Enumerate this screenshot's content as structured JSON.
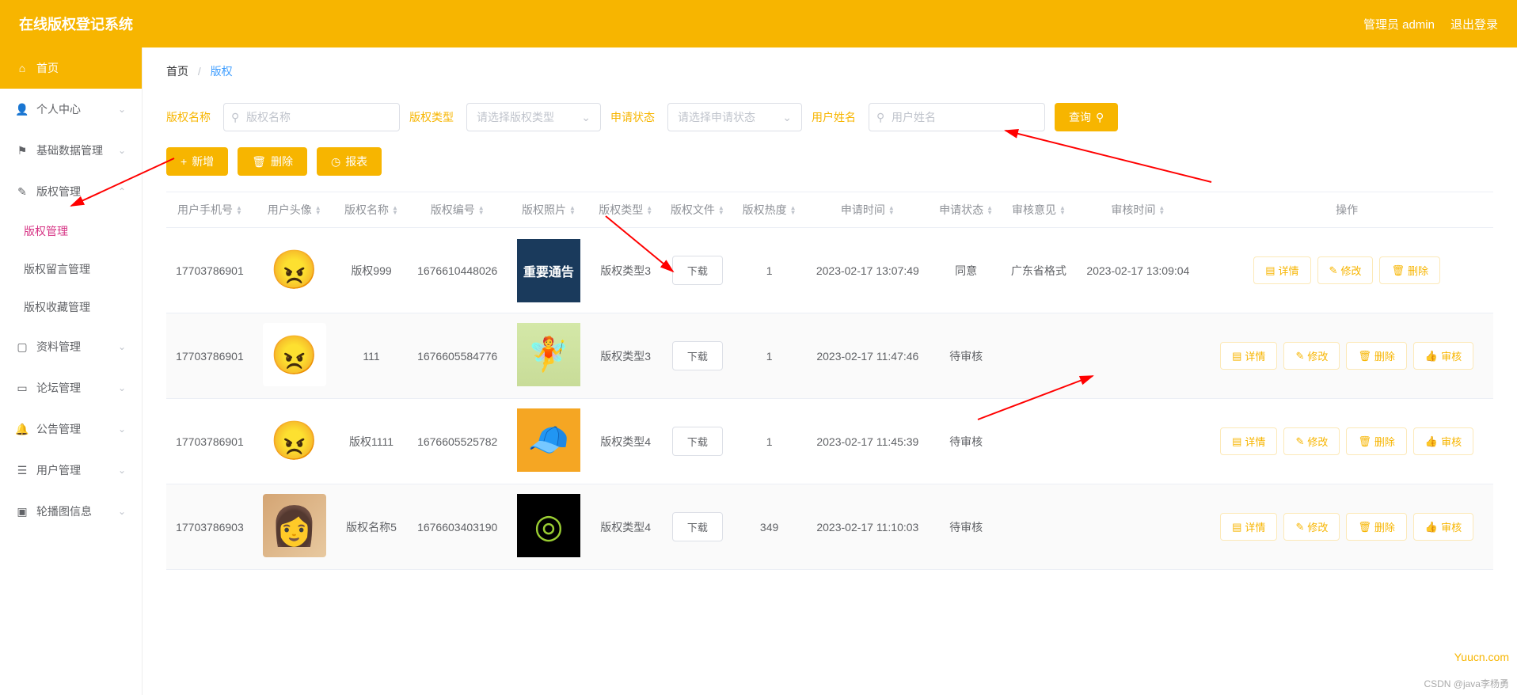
{
  "header": {
    "title": "在线版权登记系统",
    "admin_label": "管理员 admin",
    "logout_label": "退出登录"
  },
  "sidebar": {
    "items": [
      {
        "icon": "home",
        "label": "首页",
        "active_home": true
      },
      {
        "icon": "user",
        "label": "个人中心",
        "expandable": true
      },
      {
        "icon": "flag",
        "label": "基础数据管理",
        "expandable": true
      },
      {
        "icon": "copyright",
        "label": "版权管理",
        "expandable": true,
        "expanded": true,
        "children": [
          {
            "label": "版权管理",
            "active": true
          },
          {
            "label": "版权留言管理"
          },
          {
            "label": "版权收藏管理"
          }
        ]
      },
      {
        "icon": "file",
        "label": "资料管理",
        "expandable": true
      },
      {
        "icon": "forum",
        "label": "论坛管理",
        "expandable": true
      },
      {
        "icon": "announce",
        "label": "公告管理",
        "expandable": true
      },
      {
        "icon": "users",
        "label": "用户管理",
        "expandable": true
      },
      {
        "icon": "carousel",
        "label": "轮播图信息",
        "expandable": true
      }
    ]
  },
  "breadcrumb": {
    "home": "首页",
    "current": "版权"
  },
  "filters": {
    "name_label": "版权名称",
    "name_placeholder": "版权名称",
    "type_label": "版权类型",
    "type_placeholder": "请选择版权类型",
    "status_label": "申请状态",
    "status_placeholder": "请选择申请状态",
    "user_label": "用户姓名",
    "user_placeholder": "用户姓名",
    "search_btn": "查询"
  },
  "actions": {
    "add": "新增",
    "delete": "删除",
    "report": "报表"
  },
  "table": {
    "headers": {
      "phone": "用户手机号",
      "avatar": "用户头像",
      "name": "版权名称",
      "serial": "版权编号",
      "photo": "版权照片",
      "type": "版权类型",
      "file": "版权文件",
      "heat": "版权热度",
      "apply_time": "申请时间",
      "apply_status": "申请状态",
      "review_opinion": "审核意见",
      "review_time": "审核时间",
      "ops": "操作"
    },
    "download_label": "下载",
    "ops_labels": {
      "detail": "详情",
      "edit": "修改",
      "delete": "删除",
      "audit": "审核"
    },
    "rows": [
      {
        "phone": "17703786901",
        "avatar": "av1",
        "name": "版权999",
        "serial": "1676610448026",
        "photo": "ph1",
        "photo_text": "重要通告",
        "type": "版权类型3",
        "heat": "1",
        "apply_time": "2023-02-17 13:07:49",
        "apply_status": "同意",
        "review_opinion": "广东省格式",
        "review_time": "2023-02-17 13:09:04",
        "audit": false
      },
      {
        "phone": "17703786901",
        "avatar": "av1",
        "name": "111",
        "serial": "1676605584776",
        "photo": "ph2",
        "type": "版权类型3",
        "heat": "1",
        "apply_time": "2023-02-17 11:47:46",
        "apply_status": "待审核",
        "review_opinion": "",
        "review_time": "",
        "audit": true
      },
      {
        "phone": "17703786901",
        "avatar": "av1",
        "name": "版权1111",
        "serial": "1676605525782",
        "photo": "ph3",
        "type": "版权类型4",
        "heat": "1",
        "apply_time": "2023-02-17 11:45:39",
        "apply_status": "待审核",
        "review_opinion": "",
        "review_time": "",
        "audit": true
      },
      {
        "phone": "17703786903",
        "avatar": "av4",
        "name": "版权名称5",
        "serial": "1676603403190",
        "photo": "ph4",
        "type": "版权类型4",
        "heat": "349",
        "apply_time": "2023-02-17 11:10:03",
        "apply_status": "待审核",
        "review_opinion": "",
        "review_time": "",
        "audit": true
      }
    ]
  },
  "watermarks": {
    "csdn": "CSDN @java李杨勇",
    "yuucn": "Yuucn.com"
  }
}
